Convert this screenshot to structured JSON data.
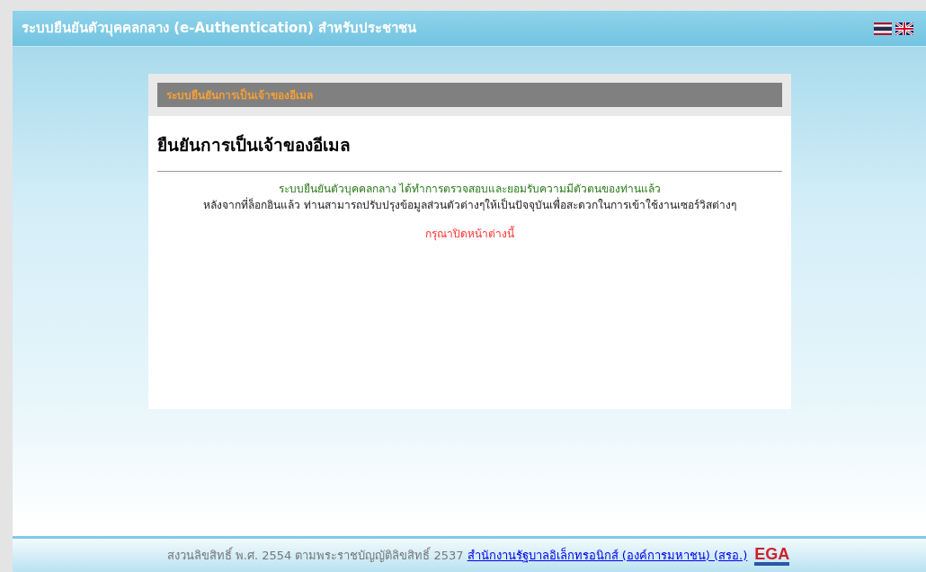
{
  "header": {
    "title": "ระบบยืนยันตัวบุคคลกลาง (e-Authentication) สำหรับประชาชน",
    "languages": [
      {
        "kind": "th"
      },
      {
        "kind": "en"
      }
    ]
  },
  "panel": {
    "title": "ระบบยืนยันการเป็นเจ้าของอีเมล",
    "heading": "ยืนยันการเป็นเจ้าของอีเมล",
    "message": "ระบบยืนยันตัวบุคคลกลาง ได้ทำการตรวจสอบและยอมรับความมีตัวตนของท่านแล้ว",
    "detail": "หลังจากที่ล็อกอินแล้ว ท่านสามารถปรับปรุงข้อมูลส่วนตัวต่างๆให้เป็นปัจจุบันเพื่อสะดวกในการเข้าใช้งานเซอร์วิสต่างๆ",
    "notice": "กรุณาปิดหน้าต่างนี้"
  },
  "footer": {
    "copyright": "สงวนลิขสิทธิ์ พ.ศ. 2554 ตามพระราชบัญญัติลิขสิทธิ์ 2537",
    "link": "สำนักงานรัฐบาลอิเล็กทรอนิกส์ (องค์การมหาชน) (สรอ.)",
    "logo": "EGA"
  }
}
